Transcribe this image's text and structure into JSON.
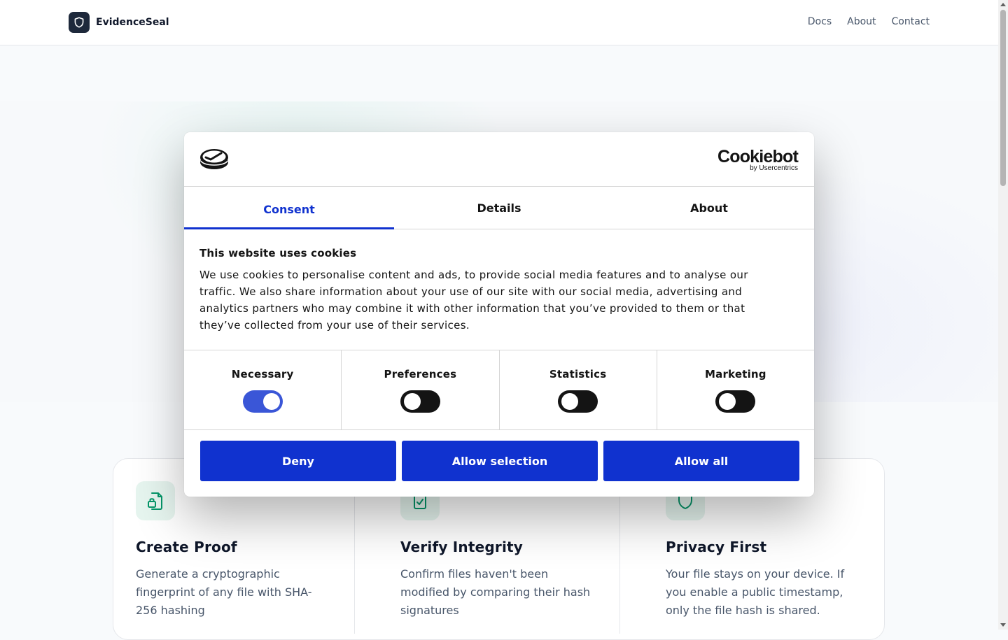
{
  "header": {
    "brand": "EvidenceSeal",
    "nav": [
      "Docs",
      "About",
      "Contact"
    ]
  },
  "features": [
    {
      "icon": "file-lock-icon",
      "title": "Create Proof",
      "description": "Generate a cryptographic fingerprint of any file with SHA-256 hashing"
    },
    {
      "icon": "clipboard-check-icon",
      "title": "Verify Integrity",
      "description": "Confirm files haven't been modified by comparing their hash signatures"
    },
    {
      "icon": "shield-icon",
      "title": "Privacy First",
      "description": "Your file stays on your device. If you enable a public timestamp, only the file hash is shared."
    }
  ],
  "cookie_dialog": {
    "brand": "Cookiebot",
    "brand_sub": "by Usercentrics",
    "tabs": [
      "Consent",
      "Details",
      "About"
    ],
    "active_tab": "Consent",
    "title": "This website uses cookies",
    "body": "We use cookies to personalise content and ads, to provide social media features and to analyse our traffic. We also share information about your use of our site with our social media, advertising and analytics partners who may combine it with other information that you’ve provided to them or that they’ve collected from your use of their services.",
    "toggles": [
      {
        "label": "Necessary",
        "on": true
      },
      {
        "label": "Preferences",
        "on": false
      },
      {
        "label": "Statistics",
        "on": false
      },
      {
        "label": "Marketing",
        "on": false
      }
    ],
    "buttons": [
      "Deny",
      "Allow selection",
      "Allow all"
    ]
  },
  "colors": {
    "accent": "#1032cf",
    "brand_dark": "#1e293b",
    "feature_green": "#059669"
  }
}
